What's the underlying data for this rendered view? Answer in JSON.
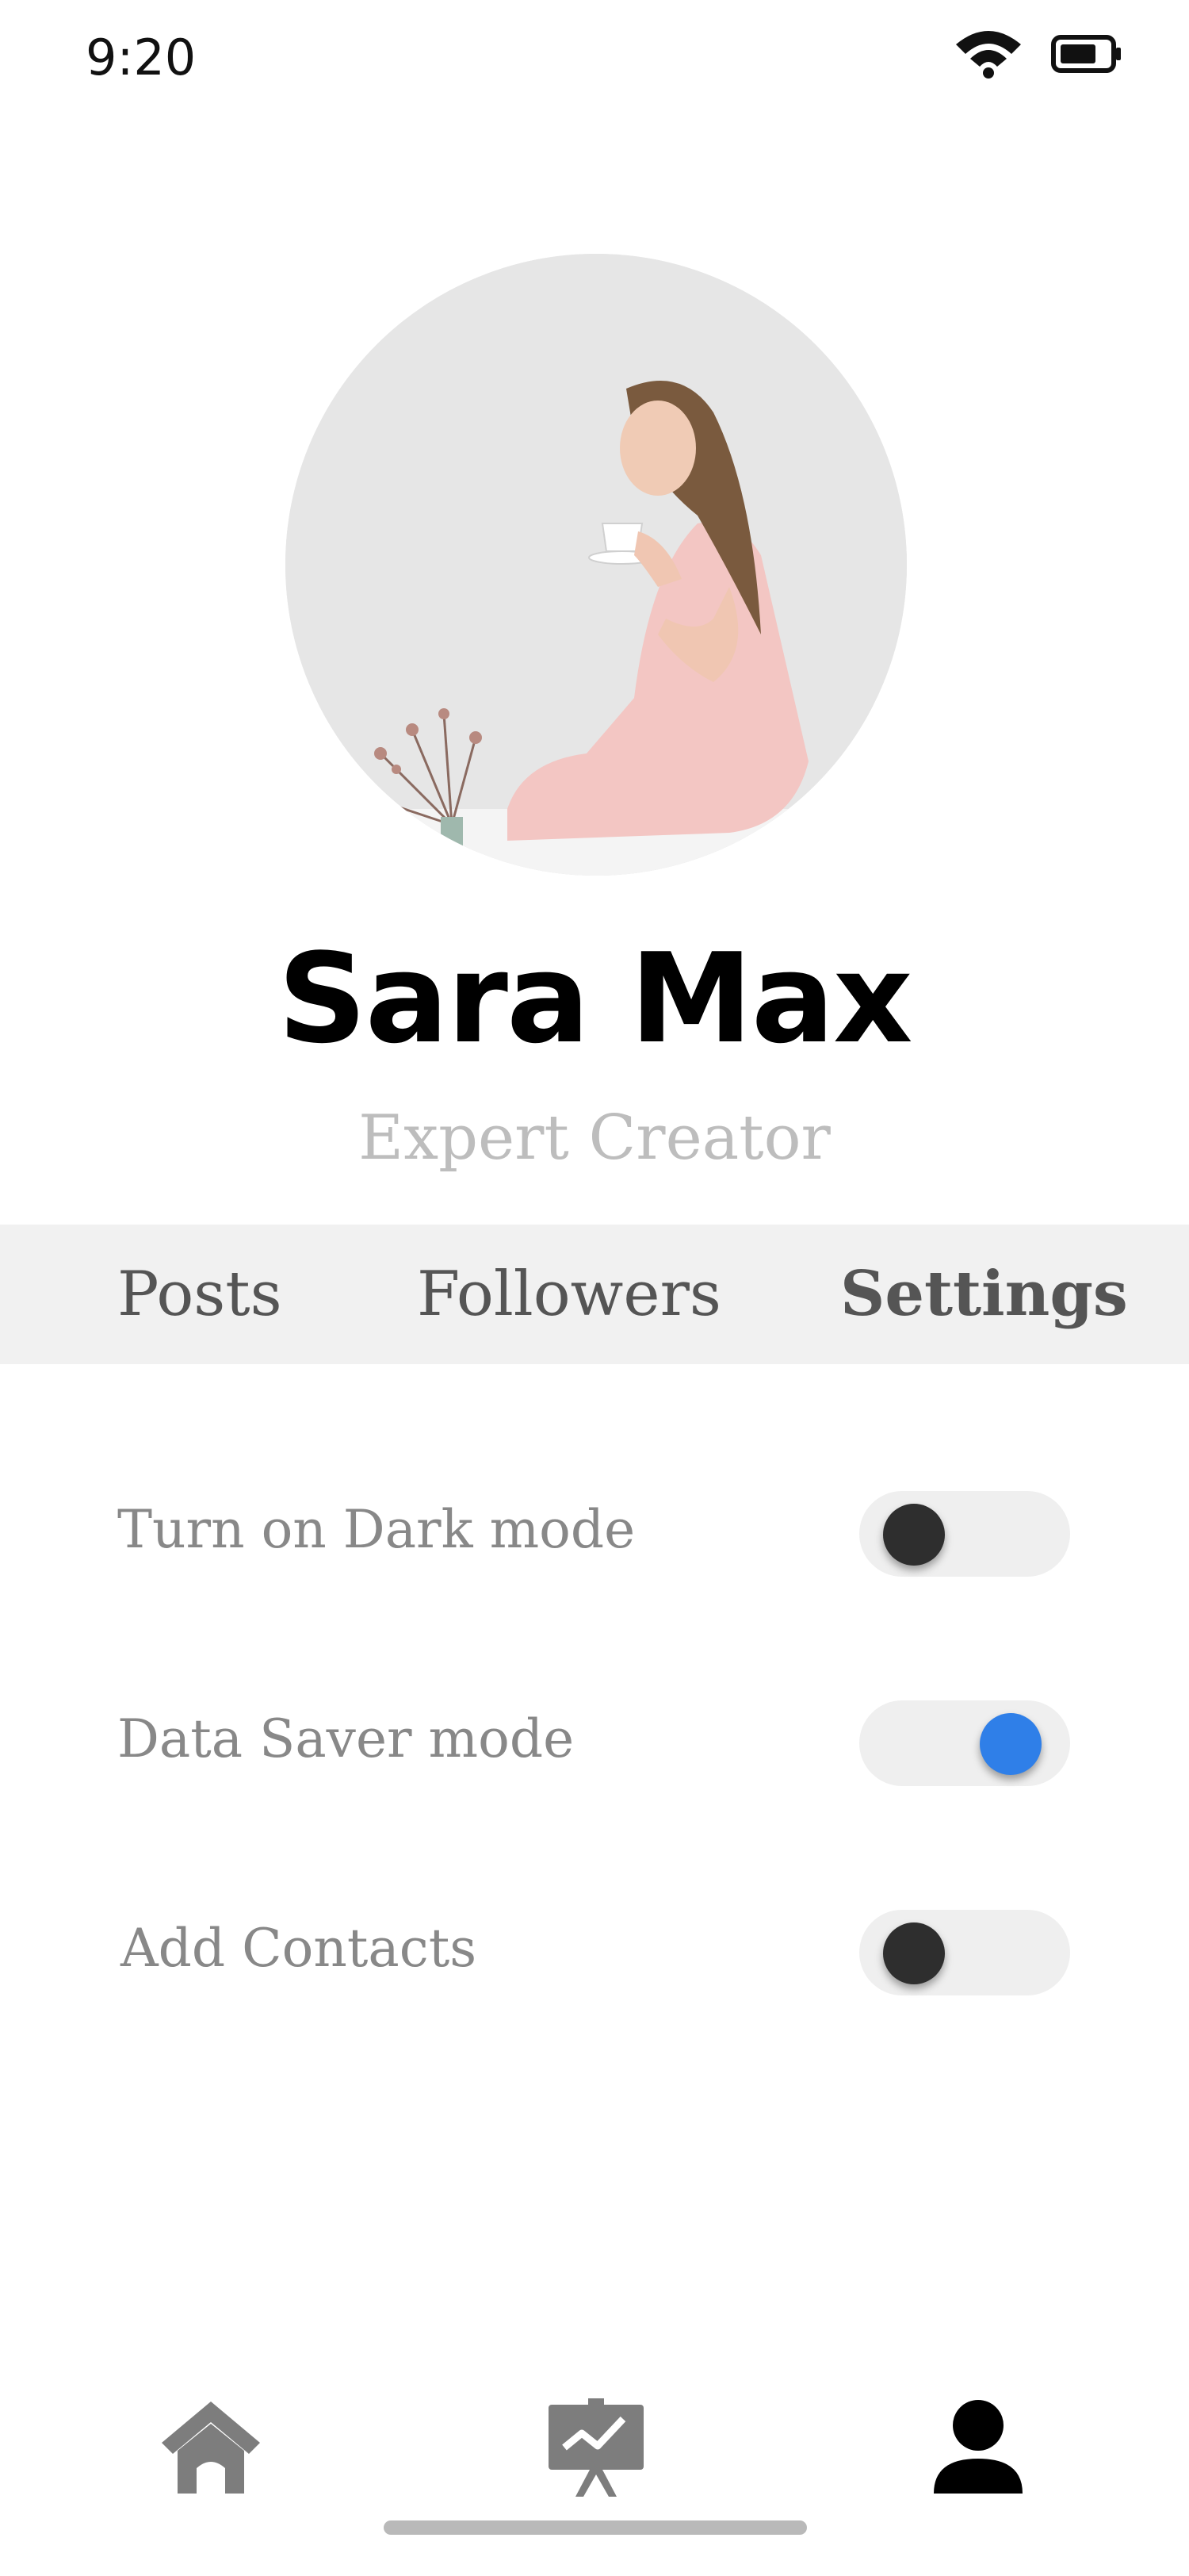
{
  "status_bar": {
    "time": "9:20",
    "wifi_icon": "wifi-icon",
    "battery_icon": "battery-icon"
  },
  "profile": {
    "name": "Sara Max",
    "subtitle": "Expert Creator",
    "avatar_icon": "profile-photo"
  },
  "tabs": [
    {
      "label": "Posts",
      "active": false
    },
    {
      "label": "Followers",
      "active": false
    },
    {
      "label": "Settings",
      "active": true
    }
  ],
  "settings": [
    {
      "label": "Turn on Dark mode",
      "enabled": false
    },
    {
      "label": "Data Saver mode",
      "enabled": true
    },
    {
      "label": "Add Contacts",
      "enabled": false
    }
  ],
  "colors": {
    "accent": "#2f7fe8",
    "tab_bg": "#f1f1f1",
    "muted_text": "#888888"
  },
  "bottom_nav": [
    {
      "icon": "home-icon"
    },
    {
      "icon": "chart-board-icon"
    },
    {
      "icon": "profile-icon",
      "active": true
    }
  ]
}
